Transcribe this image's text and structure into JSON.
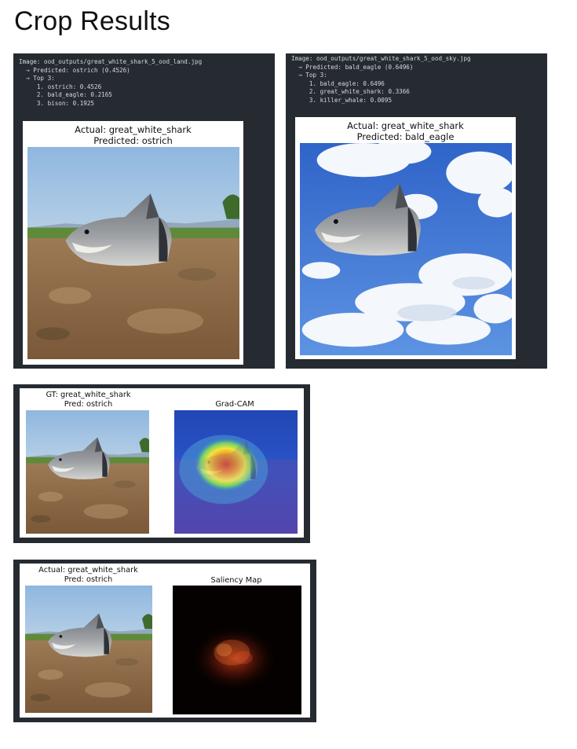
{
  "page": {
    "title": "Crop Results"
  },
  "land_panel": {
    "lines": [
      "Image: ood_outputs/great_white_shark_5_ood_land.jpg",
      "  → Predicted: ostrich (0.4526)",
      "  → Top 3:",
      "     1. ostrich: 0.4526",
      "     2. bald_eagle: 0.2165",
      "     3. bison: 0.1925"
    ],
    "actual": "Actual: great_white_shark",
    "predicted": "Predicted: ostrich"
  },
  "sky_panel": {
    "lines": [
      "Image: ood_outputs/great_white_shark_5_ood_sky.jpg",
      "  → Predicted: bald_eagle (0.6496)",
      "  → Top 3:",
      "     1. bald_eagle: 0.6496",
      "     2. great_white_shark: 0.3366",
      "     3. killer_whale: 0.0095"
    ],
    "actual": "Actual: great_white_shark",
    "predicted": "Predicted: bald_eagle"
  },
  "gradcam_panel": {
    "gt": "GT: great_white_shark",
    "pred": "Pred: ostrich",
    "map_title": "Grad-CAM"
  },
  "saliency_panel": {
    "actual": "Actual: great_white_shark",
    "pred": "Pred: ostrich",
    "map_title": "Saliency Map"
  }
}
